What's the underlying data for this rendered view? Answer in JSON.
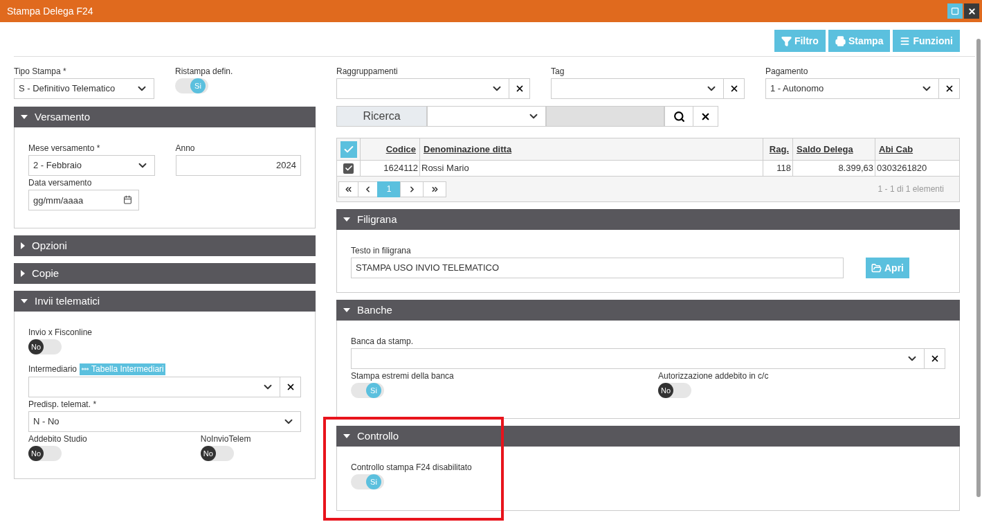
{
  "window": {
    "title": "Stampa Delega F24"
  },
  "toolbar": [
    {
      "label": "Filtro",
      "kind": "filter"
    },
    {
      "label": "Stampa",
      "kind": "print"
    },
    {
      "label": "Funzioni",
      "kind": "menu"
    }
  ],
  "tipo_stampa": {
    "label": "Tipo Stampa *",
    "value": "S - Definitivo Telematico"
  },
  "ristampa": {
    "label": "Ristampa defin.",
    "on": true,
    "text": "Si"
  },
  "versamento": {
    "title": "Versamento",
    "expanded": true,
    "mese": {
      "label": "Mese versamento *",
      "value": "2 - Febbraio"
    },
    "anno": {
      "label": "Anno",
      "value": "2024"
    },
    "data": {
      "label": "Data versamento",
      "placeholder": "gg/mm/aaaa"
    }
  },
  "opzioni": {
    "title": "Opzioni",
    "expanded": false
  },
  "copie": {
    "title": "Copie",
    "expanded": false
  },
  "invii": {
    "title": "Invii telematici",
    "expanded": true,
    "fisconline": {
      "label": "Invio x Fisconline",
      "on": false,
      "text": "No"
    },
    "intermediario": {
      "label": "Intermediario",
      "link": "Tabella Intermediari"
    },
    "predisp": {
      "label": "Predisp. telemat. *",
      "value": "N - No"
    },
    "addebito": {
      "label": "Addebito Studio",
      "on": false,
      "text": "No"
    },
    "noinvio": {
      "label": "NoInvioTelem",
      "on": false,
      "text": "No"
    }
  },
  "raggruppamenti": {
    "label": "Raggruppamenti"
  },
  "tag": {
    "label": "Tag"
  },
  "pagamento": {
    "label": "Pagamento",
    "value": "1 - Autonomo"
  },
  "ricerca": {
    "label": "Ricerca"
  },
  "table": {
    "all_checked": true,
    "columns": [
      "Codice",
      "Denominazione ditta",
      "Rag.",
      "Saldo Delega",
      "Abi Cab"
    ],
    "rows": [
      {
        "checked": true,
        "cells": [
          "1624112",
          "Rossi Mario",
          "118",
          "8.399,63",
          "0303261820"
        ]
      }
    ]
  },
  "pager": {
    "pages": [
      {
        "label": "1",
        "selected": true
      }
    ],
    "summary": "1 - 1 di 1 elementi"
  },
  "filigrana": {
    "title": "Filigrana",
    "expanded": true,
    "testo": {
      "label": "Testo in filigrana",
      "value": "STAMPA USO INVIO TELEMATICO"
    },
    "button": "Apri"
  },
  "banche": {
    "title": "Banche",
    "expanded": true,
    "banca": {
      "label": "Banca da stamp."
    },
    "estremi": {
      "label": "Stampa estremi della banca",
      "on": true,
      "text": "Si"
    },
    "autorizzazione": {
      "label": "Autorizzazione addebito in c/c",
      "on": false,
      "text": "No"
    }
  },
  "controllo": {
    "title": "Controllo",
    "expanded": true,
    "disabilitato": {
      "label": "Controllo stampa F24 disabilitato",
      "on": true,
      "text": "Si"
    }
  }
}
